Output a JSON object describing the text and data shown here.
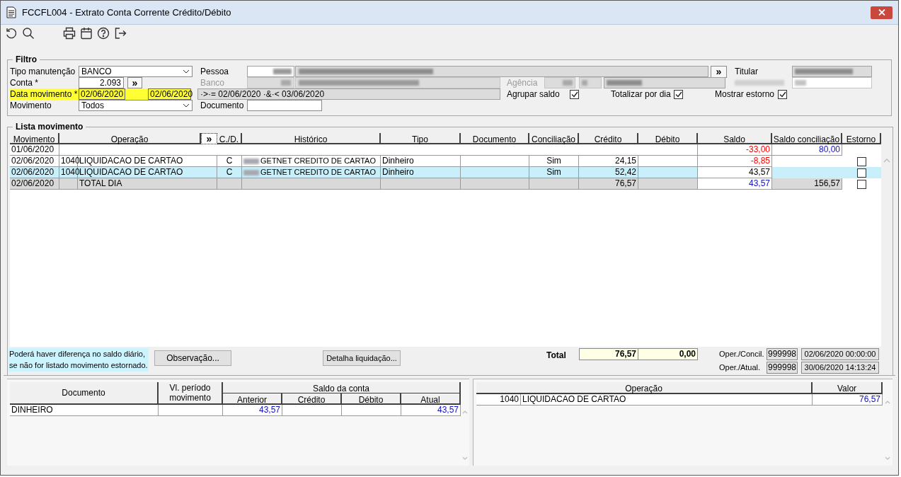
{
  "window": {
    "title": "FCCFL004 - Extrato Conta Corrente Crédito/Débito"
  },
  "filtro": {
    "legend": "Filtro",
    "tipo_manutencao": {
      "label": "Tipo manutenção",
      "value": "BANCO"
    },
    "conta": {
      "label": "Conta *",
      "value": "2.093",
      "button": "»"
    },
    "data_movimento": {
      "label": "Data movimento *",
      "from": "02/06/2020",
      "to": "02/06/2020",
      "expression": "·>·= 02/06/2020 ·&·< 03/06/2020"
    },
    "movimento": {
      "label": "Movimento",
      "value": "Todos"
    },
    "pessoa": {
      "label": "Pessoa",
      "button": "»"
    },
    "titular": {
      "label": "Titular"
    },
    "banco": {
      "label": "Banco",
      "disabled": true
    },
    "agencia": {
      "label": "Agência",
      "disabled": true
    },
    "documento": {
      "label": "Documento"
    },
    "options": [
      {
        "label": "Agrupar saldo",
        "checked": true
      },
      {
        "label": "Totalizar por dia",
        "checked": true
      },
      {
        "label": "Mostrar estorno",
        "checked": true
      }
    ]
  },
  "lista": {
    "legend": "Lista movimento",
    "expand_button": "»",
    "columns": [
      "Movimento",
      "Operação",
      "C./D.",
      "Histórico",
      "Tipo",
      "Documento",
      "Conciliação",
      "Crédito",
      "Débito",
      "Saldo",
      "Saldo conciliação",
      "Estorno"
    ],
    "rows": [
      {
        "kind": "balance",
        "movimento": "01/06/2020",
        "saldo": "-33,00",
        "saldo_conciliacao": "80,00",
        "selected": false
      },
      {
        "kind": "entry",
        "movimento": "02/06/2020",
        "codigo": "1040",
        "operacao": "LIQUIDACAO DE CARTAO",
        "cd": "C",
        "historico": "GETNET CREDITO DE CARTAO",
        "tipo": "Dinheiro",
        "conciliacao": "Sim",
        "credito": "24,15",
        "saldo": "-8,85",
        "estorno": false,
        "selected": false
      },
      {
        "kind": "entry",
        "movimento": "02/06/2020",
        "codigo": "1040",
        "operacao": "LIQUIDACAO DE CARTAO",
        "cd": "C",
        "historico": "GETNET CREDITO DE CARTAO",
        "tipo": "Dinheiro",
        "conciliacao": "Sim",
        "credito": "52,42",
        "saldo": "43,57",
        "estorno": false,
        "selected": true
      },
      {
        "kind": "total",
        "movimento": "02/06/2020",
        "operacao": "TOTAL DIA",
        "credito": "76,57",
        "saldo": "43,57",
        "saldo_conciliacao": "156,57",
        "estorno": false,
        "selected": false
      }
    ]
  },
  "footer": {
    "note": "Poderá haver diferença no saldo diário,\nse não for listado movimento estornado.",
    "buttons": [
      "Observação...",
      "Detalha liquidação..."
    ],
    "total": {
      "label": "Total",
      "credito": "76,57",
      "debito": "0,00"
    },
    "oper": [
      {
        "label": "Oper./Concil.",
        "code": "999998",
        "datetime": "02/06/2020 00:00:00"
      },
      {
        "label": "Oper./Atual.",
        "code": "999998",
        "datetime": "30/06/2020 14:13:24"
      }
    ]
  },
  "documentos": {
    "columns": {
      "documento": "Documento",
      "vl_periodo": "Vl. período movimento",
      "saldo_group": "Saldo da conta",
      "anterior": "Anterior",
      "credito": "Crédito",
      "debito": "Débito",
      "atual": "Atual"
    },
    "rows": [
      {
        "documento": "DINHEIRO",
        "anterior": "43,57",
        "atual": "43,57"
      }
    ]
  },
  "operacoes": {
    "columns": [
      "Operação",
      "Valor"
    ],
    "rows": [
      {
        "codigo": "1040",
        "operacao": "LIQUIDACAO DE CARTAO",
        "valor": "76,57"
      }
    ]
  }
}
